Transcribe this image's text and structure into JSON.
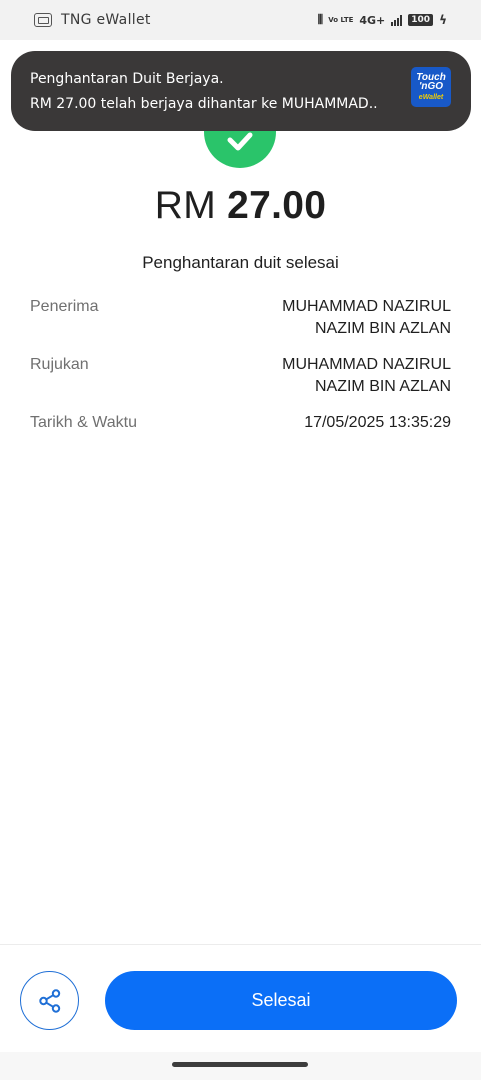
{
  "status_bar": {
    "app_name": "TNG eWallet",
    "network": "4G+",
    "volte": "Vo LTE",
    "battery": "100"
  },
  "notification": {
    "title": "Penghantaran Duit Berjaya.",
    "body": "RM 27.00 telah berjaya dihantar ke MUHAMMAD..",
    "logo": {
      "line1": "Touch",
      "line2": "'nGO",
      "line3": "eWallet"
    }
  },
  "transaction": {
    "currency": "RM",
    "amount": "27.00",
    "status": "Penghantaran duit selesai"
  },
  "details": {
    "recipient_label": "Penerima",
    "recipient_value_line1": "MUHAMMAD NAZIRUL",
    "recipient_value_line2": "NAZIM BIN AZLAN",
    "reference_label": "Rujukan",
    "reference_value_line1": "MUHAMMAD NAZIRUL",
    "reference_value_line2": "NAZIM BIN AZLAN",
    "datetime_label": "Tarikh & Waktu",
    "datetime_value": "17/05/2025 13:35:29"
  },
  "actions": {
    "done_label": "Selesai"
  },
  "colors": {
    "accent": "#0b6ff7",
    "success": "#2ac46a",
    "banner": "#3a3838"
  },
  "icons": [
    "tng-app-icon",
    "vibrate-icon",
    "signal-icon",
    "battery-icon",
    "charging-icon",
    "check-icon",
    "share-icon"
  ]
}
